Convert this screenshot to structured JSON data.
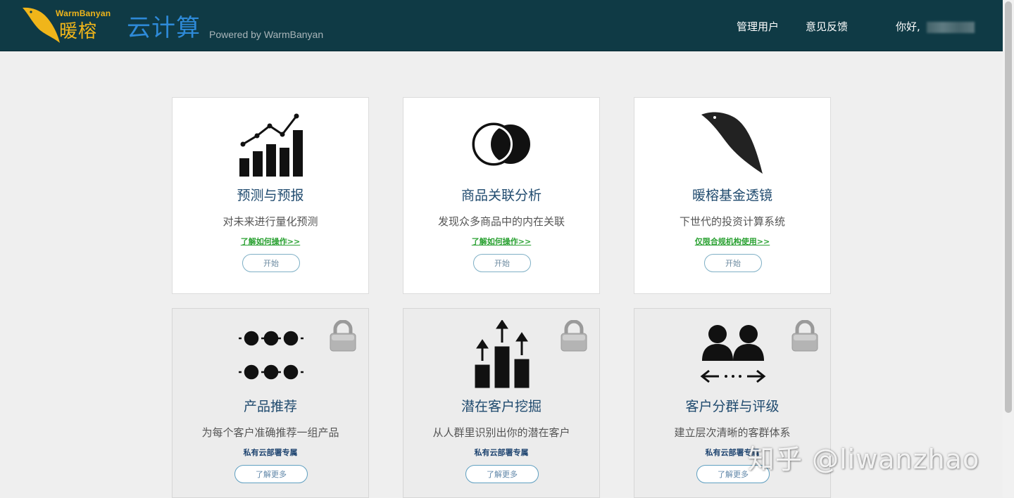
{
  "header": {
    "logo_en": "WarmBanyan",
    "logo_cn": "暖榕",
    "app_title": "云计算",
    "powered_by": "Powered by WarmBanyan",
    "nav_admin": "管理用户",
    "nav_feedback": "意见反馈",
    "greeting": "你好,",
    "colors": {
      "bar": "#0f3a45",
      "logo": "#f0b51a",
      "title": "#2e8ad8"
    }
  },
  "cards": [
    {
      "icon": "bar-chart-trend-icon",
      "title": "预测与预报",
      "desc": "对未来进行量化预测",
      "link": "了解如何操作>>",
      "button": "开始"
    },
    {
      "icon": "overlap-circles-icon",
      "title": "商品关联分析",
      "desc": "发现众多商品中的内在关联",
      "link": "了解如何操作>>",
      "button": "开始"
    },
    {
      "icon": "bird-head-icon",
      "title": "暖榕基金透镜",
      "desc": "下世代的投资计算系统",
      "link": "仅限合规机构使用>>",
      "button": "开始"
    },
    {
      "icon": "dot-chain-icon",
      "title": "产品推荐",
      "desc": "为每个客户准确推荐一组产品",
      "note": "私有云部署专属",
      "button": "了解更多",
      "locked": true
    },
    {
      "icon": "rising-bars-icon",
      "title": "潜在客户挖掘",
      "desc": "从人群里识别出你的潜在客户",
      "note": "私有云部署专属",
      "button": "了解更多",
      "locked": true
    },
    {
      "icon": "user-groups-icon",
      "title": "客户分群与评级",
      "desc": "建立层次清晰的客群体系",
      "note": "私有云部署专属",
      "button": "了解更多",
      "locked": true
    }
  ],
  "watermark": "知乎 @liwanzhao"
}
